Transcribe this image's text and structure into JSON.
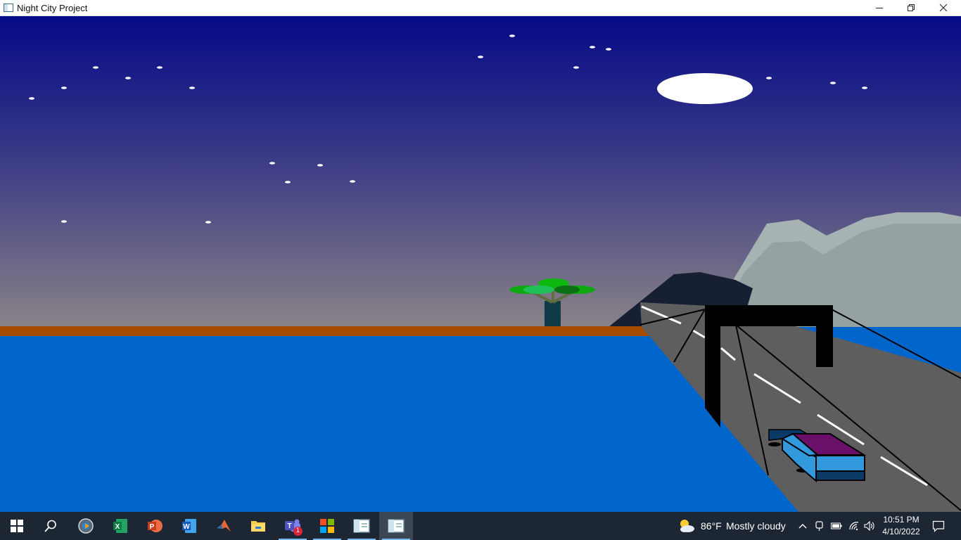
{
  "window": {
    "title": "Night City Project",
    "controls": {
      "minimize": "—",
      "maximize": "❐",
      "close": "✕"
    }
  },
  "scene": {
    "colors": {
      "sky_top": "#050a87",
      "sky_mid": "#3a3a86",
      "sky_bottom": "#8a8387",
      "ground_strip": "#a64c00",
      "water": "#0066cc",
      "road": "#5e5e5e",
      "mountain_light": "#9aa9a9",
      "mountain_dark": "#162032",
      "moon": "#ffffff",
      "gate": "#000000",
      "car_body": "#3399dd",
      "car_roof": "#6a0f6a",
      "car_dark": "#0b3a66",
      "tree_trunk": "#0f3a48",
      "tree_leaves": "#1fbf2f"
    }
  },
  "taskbar": {
    "items": [
      {
        "name": "start-button",
        "icon": "windows-logo-icon"
      },
      {
        "name": "search-button",
        "icon": "search-icon"
      },
      {
        "name": "app-media",
        "icon": "media-player-icon"
      },
      {
        "name": "app-excel",
        "icon": "excel-icon",
        "letter": "X"
      },
      {
        "name": "app-powerpoint",
        "icon": "powerpoint-icon",
        "letter": "P"
      },
      {
        "name": "app-word",
        "icon": "word-icon",
        "letter": "W"
      },
      {
        "name": "app-matlab",
        "icon": "matlab-icon"
      },
      {
        "name": "app-file-explorer",
        "icon": "folder-icon"
      },
      {
        "name": "app-teams",
        "icon": "teams-icon",
        "letter": "T",
        "badge": "1"
      },
      {
        "name": "app-store",
        "icon": "store-icon"
      },
      {
        "name": "app-window-1",
        "icon": "app-window-icon"
      },
      {
        "name": "app-window-2",
        "icon": "app-window-icon"
      }
    ],
    "weather": {
      "temp": "86°F",
      "condition": "Mostly cloudy",
      "icon": "partly-cloudy-icon"
    },
    "tray_icons": [
      "chevron-up-icon",
      "meet-now-icon",
      "battery-icon",
      "wifi-icon",
      "volume-icon"
    ],
    "clock": {
      "time": "10:51 PM",
      "date": "4/10/2022"
    },
    "notifications_icon": "notification-icon"
  }
}
